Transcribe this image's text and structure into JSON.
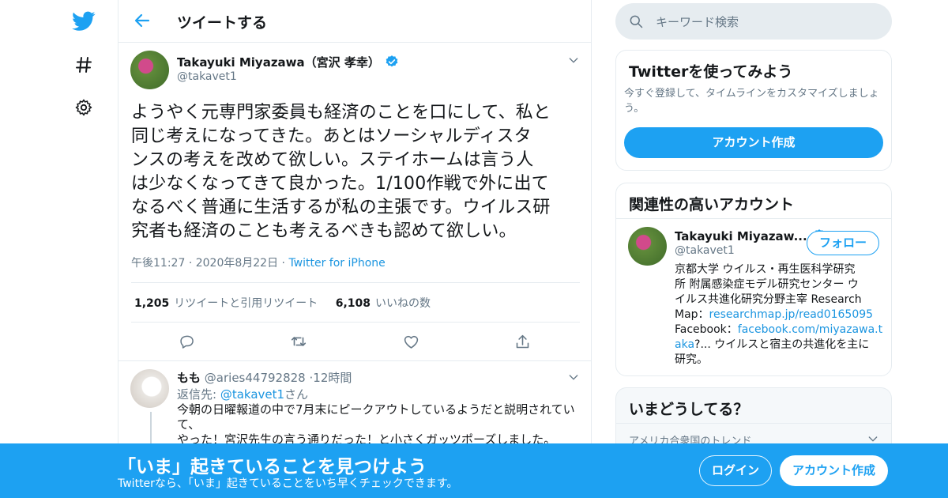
{
  "colors": {
    "accent": "#1da1f2",
    "link": "#1b95e0",
    "muted": "#657786",
    "border": "#e6ecf0",
    "banner": "#1da1f2"
  },
  "nav": {
    "icons": [
      "twitter-bird-icon",
      "hashtag-icon",
      "gear-icon"
    ]
  },
  "header": {
    "title": "ツイートする",
    "back_icon": "arrow-left-icon"
  },
  "tweet": {
    "author_name": "Takayuki Miyazawa（宮沢 孝幸）",
    "author_handle": "@takavet1",
    "text_lines": [
      "ようやく元専門家委員も経済のことを口にして、私と",
      "同じ考えになってきた。あとはソーシャルディスタ",
      "ンスの考えを改めて欲しい。ステイホームは言う人",
      "は少なくなってきて良かった。1/100作戦で外に出て",
      "なるべく普通に生活するが私の主張です。ウイルス研",
      "究者も経済のことも考えるべきも認めて欲しい。"
    ],
    "time": "午後11:27",
    "date": "2020年8月22日",
    "dot": "·",
    "source": "Twitter for iPhone",
    "retweet_count": "1,205",
    "retweet_label": "リツイートと引用リツイート",
    "like_count": "6,108",
    "like_label": "いいねの数"
  },
  "reply": {
    "name": "もも",
    "handle": "@aries44792828",
    "time": "12時間",
    "reply_to_prefix": "返信先: ",
    "reply_to_handle": "@takavet1",
    "reply_to_suffix": "さん",
    "text_lines": [
      "今朝の日曜報道の中で7月末にピークアウトしているようだと説明されてい",
      "て、",
      "やった！宮沢先生の言う通りだった！と小さくガッツポーズしました。"
    ]
  },
  "search": {
    "placeholder": "キーワード検索"
  },
  "signup_card": {
    "title": "Twitterを使ってみよう",
    "desc_lines": [
      "今すぐ登録して、タイムラインをカスタマイズしましょ",
      "う。"
    ],
    "button": "アカウント作成"
  },
  "related_card": {
    "title": "関連性の高いアカウント",
    "name": "Takayuki Miyazaw...",
    "handle": "@takavet1",
    "follow": "フォロー",
    "bio_1": "京都大学 ウイルス・再生医科学研究",
    "bio_2": "所 附属感染症モデル研究センター ウ",
    "bio_3": "イルス共進化研究分野主宰 Research",
    "bio_4_prefix": "Map：",
    "bio_4_link": "researchmap.jp/read0165095",
    "bio_5_prefix": "Facebook：",
    "bio_5_link": "facebook.com/miyazawa.t",
    "bio_6_link": "aka",
    "bio_6_suffix": "?... ウイルスと宿主の共進化を主に",
    "bio_7": "研究。"
  },
  "trends_card": {
    "title": "いまどうしてる？",
    "subtitle": "アメリカ合衆国のトレンド"
  },
  "banner": {
    "headline": "「いま」起きていることを見つけよう",
    "sub": "Twitterなら、「いま」起きていることをいち早くチェックできます。",
    "login": "ログイン",
    "signup": "アカウント作成"
  }
}
